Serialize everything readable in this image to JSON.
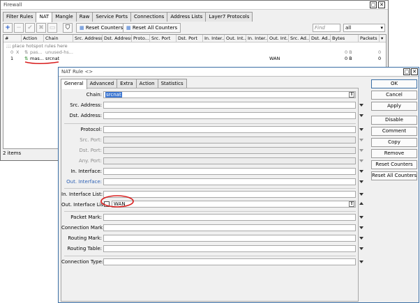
{
  "firewall": {
    "title": "Firewall",
    "tabs": [
      "Filter Rules",
      "NAT",
      "Mangle",
      "Raw",
      "Service Ports",
      "Connections",
      "Address Lists",
      "Layer7 Protocols"
    ],
    "active_tab": "NAT",
    "toolbar": {
      "reset_counters": "Reset Counters",
      "reset_all_counters": "Reset All Counters",
      "find_placeholder": "Find",
      "filter_value": "all"
    },
    "columns": [
      "#",
      "Action",
      "Chain",
      "Src. Address",
      "Dst. Address",
      "Proto...",
      "Src. Port",
      "Dst. Port",
      "In. Inter...",
      "Out. Int...",
      "In. Inter...",
      "Out. Int...",
      "Src. Ad...",
      "Dst. Ad...",
      "Bytes",
      "Packets"
    ],
    "rows": [
      {
        "note": ";;; place hotspot rules here"
      },
      {
        "num": "0",
        "flag": "X",
        "action": "pas...",
        "chain": "unused-hs...",
        "out_interface_list": "",
        "bytes": "0 B",
        "packets": "0"
      },
      {
        "num": "1",
        "flag": "",
        "action": "mas...",
        "chain": "srcnat",
        "out_interface_list": "WAN",
        "bytes": "0 B",
        "packets": "0"
      }
    ],
    "status": "2 items"
  },
  "nat_rule": {
    "title": "NAT Rule <>",
    "tabs": [
      "General",
      "Advanced",
      "Extra",
      "Action",
      "Statistics"
    ],
    "active_tab": "General",
    "fields": {
      "chain": {
        "label": "Chain:",
        "value": "srcnat"
      },
      "src_address": {
        "label": "Src. Address:"
      },
      "dst_address": {
        "label": "Dst. Address:"
      },
      "protocol": {
        "label": "Protocol:"
      },
      "src_port": {
        "label": "Src. Port:"
      },
      "dst_port": {
        "label": "Dst. Port:"
      },
      "any_port": {
        "label": "Any. Port:"
      },
      "in_interface": {
        "label": "In. Interface:"
      },
      "out_interface": {
        "label": "Out. Interface:"
      },
      "in_interface_list": {
        "label": "In. Interface List:"
      },
      "out_interface_list": {
        "label": "Out. Interface List:",
        "value": "WAN"
      },
      "packet_mark": {
        "label": "Packet Mark:"
      },
      "connection_mark": {
        "label": "Connection Mark:"
      },
      "routing_mark": {
        "label": "Routing Mark:"
      },
      "routing_table": {
        "label": "Routing Table:"
      },
      "connection_type": {
        "label": "Connection Type:"
      }
    },
    "buttons": [
      "OK",
      "Cancel",
      "Apply",
      "Disable",
      "Comment",
      "Copy",
      "Remove",
      "Reset Counters",
      "Reset All Counters"
    ]
  },
  "colors": {
    "accent_blue": "#3c76d2",
    "annotation_red": "#d81e1e",
    "disabled_text": "#8c8c8c"
  }
}
